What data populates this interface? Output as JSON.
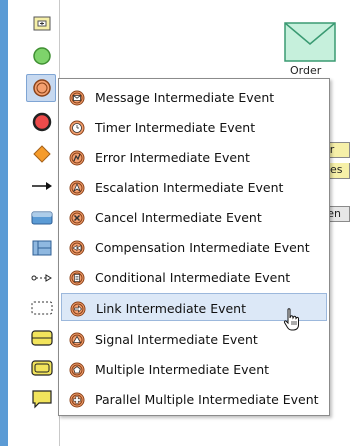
{
  "palette": {
    "tools": [
      {
        "name": "collapse-toggle-icon"
      },
      {
        "name": "start-event-icon"
      },
      {
        "name": "intermediate-event-icon",
        "selected": true
      },
      {
        "name": "end-event-icon"
      },
      {
        "name": "gateway-icon"
      },
      {
        "name": "sequence-flow-icon"
      },
      {
        "name": "task-icon"
      },
      {
        "name": "pool-icon"
      },
      {
        "name": "message-flow-icon"
      },
      {
        "name": "group-icon"
      },
      {
        "name": "subprocess-icon"
      },
      {
        "name": "transaction-icon"
      },
      {
        "name": "annotation-icon"
      }
    ]
  },
  "canvas": {
    "order_label": "Order",
    "task_fragments": [
      "er",
      "ues",
      "ren"
    ]
  },
  "menu": {
    "items": [
      {
        "label": "Message Intermediate Event",
        "icon": "message-event-icon"
      },
      {
        "label": "Timer Intermediate Event",
        "icon": "timer-event-icon"
      },
      {
        "label": "Error Intermediate Event",
        "icon": "error-event-icon"
      },
      {
        "label": "Escalation Intermediate Event",
        "icon": "escalation-event-icon"
      },
      {
        "label": "Cancel Intermediate Event",
        "icon": "cancel-event-icon"
      },
      {
        "label": "Compensation Intermediate Event",
        "icon": "compensation-event-icon"
      },
      {
        "label": "Conditional Intermediate Event",
        "icon": "conditional-event-icon"
      },
      {
        "label": "Link Intermediate Event",
        "icon": "link-event-icon",
        "highlighted": true
      },
      {
        "label": "Signal Intermediate Event",
        "icon": "signal-event-icon"
      },
      {
        "label": "Multiple Intermediate Event",
        "icon": "multiple-event-icon"
      },
      {
        "label": "Parallel Multiple Intermediate Event",
        "icon": "parallel-multiple-event-icon"
      }
    ]
  },
  "colors": {
    "event_fill": "#f4a070",
    "event_stroke": "#b05a2a",
    "menu_highlight": "#dce8f7"
  }
}
